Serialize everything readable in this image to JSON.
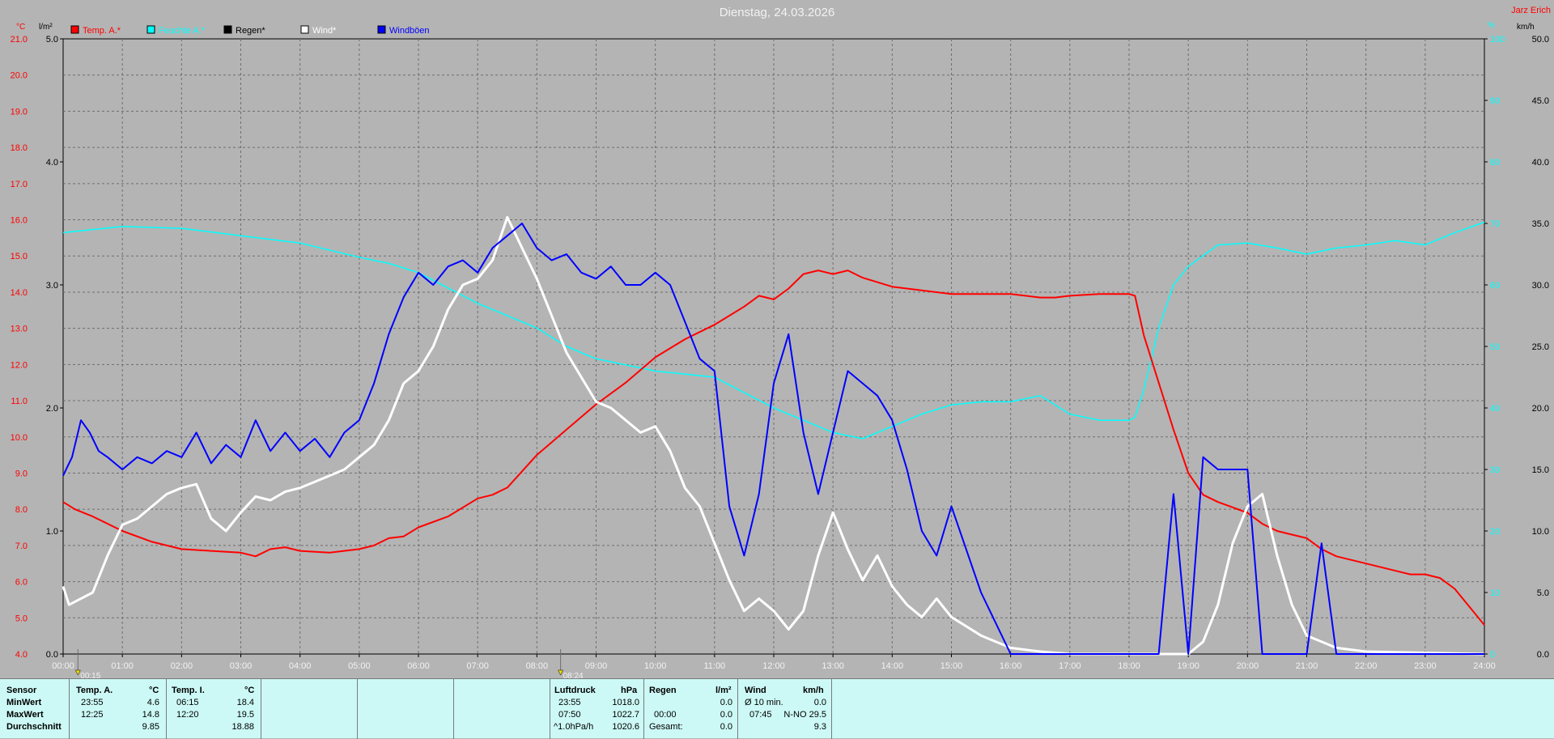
{
  "title": "Dienstag, 24.03.2026",
  "station": "Jarz Erich",
  "legend": [
    {
      "label": "Temp. A.*",
      "color": "#ff0000"
    },
    {
      "label": "Feuchte A.*",
      "color": "#00ffff"
    },
    {
      "label": "Regen*",
      "color": "#000000"
    },
    {
      "label": "Wind*",
      "color": "#ffffff"
    },
    {
      "label": "Windböen",
      "color": "#0000ff"
    }
  ],
  "axes": {
    "left_temp_unit": "°C",
    "left_rain_unit": "l/m²",
    "right_hum_unit": "%",
    "right_wind_unit": "km/h",
    "temp_ticks": [
      "21.0",
      "20.0",
      "19.0",
      "18.0",
      "17.0",
      "16.0",
      "15.0",
      "14.0",
      "13.0",
      "12.0",
      "11.0",
      "10.0",
      "9.0",
      "8.0",
      "7.0",
      "6.0",
      "5.0",
      "4.0"
    ],
    "rain_ticks": [
      "5.0",
      "4.0",
      "3.0",
      "2.0",
      "1.0",
      "0.0"
    ],
    "hum_ticks": [
      "100",
      "90",
      "80",
      "70",
      "60",
      "50",
      "40",
      "30",
      "20",
      "10",
      "0"
    ],
    "wind_ticks": [
      "50.0",
      "45.0",
      "40.0",
      "35.0",
      "30.0",
      "25.0",
      "20.0",
      "15.0",
      "10.0",
      "5.0",
      "0.0"
    ],
    "time_ticks": [
      "00:00",
      "01:00",
      "02:00",
      "03:00",
      "04:00",
      "05:00",
      "06:00",
      "07:00",
      "08:00",
      "09:00",
      "10:00",
      "11:00",
      "12:00",
      "13:00",
      "14:00",
      "15:00",
      "16:00",
      "17:00",
      "18:00",
      "19:00",
      "20:00",
      "21:00",
      "22:00",
      "23:00",
      "24:00"
    ],
    "markers": [
      "00:15",
      "08:24"
    ]
  },
  "chart_data": {
    "type": "line",
    "title": "Dienstag, 24.03.2026",
    "x_unit": "hours",
    "temp_range": [
      4,
      21
    ],
    "rain_range": [
      0,
      5
    ],
    "hum_range": [
      0,
      100
    ],
    "wind_range": [
      0,
      50
    ],
    "grid": true,
    "legend_position": "top-left",
    "series": [
      {
        "name": "Temp. A.*",
        "axis": "temp",
        "color": "#ff0000",
        "x": [
          0,
          0.2,
          0.5,
          1,
          1.5,
          2,
          2.5,
          3,
          3.25,
          3.5,
          3.75,
          4,
          4.5,
          5,
          5.25,
          5.5,
          5.75,
          6,
          6.5,
          7,
          7.25,
          7.5,
          8,
          8.5,
          9,
          9.5,
          10,
          10.5,
          11,
          11.5,
          11.75,
          12,
          12.25,
          12.5,
          12.75,
          13,
          13.25,
          13.5,
          14,
          14.5,
          15,
          15.5,
          16,
          16.25,
          16.5,
          16.75,
          17,
          17.5,
          18,
          18.1,
          18.25,
          18.5,
          18.75,
          19,
          19.25,
          19.5,
          20,
          20.25,
          20.5,
          20.75,
          21,
          21.25,
          21.5,
          22,
          22.5,
          22.75,
          23,
          23.25,
          23.5,
          23.75,
          24
        ],
        "values": [
          8.2,
          8.0,
          7.8,
          7.4,
          7.1,
          6.9,
          6.85,
          6.8,
          6.7,
          6.9,
          6.95,
          6.85,
          6.8,
          6.9,
          7.0,
          7.2,
          7.25,
          7.5,
          7.8,
          8.3,
          8.4,
          8.6,
          9.5,
          10.2,
          10.9,
          11.5,
          12.2,
          12.7,
          13.1,
          13.6,
          13.9,
          13.8,
          14.1,
          14.5,
          14.6,
          14.5,
          14.6,
          14.4,
          14.15,
          14.05,
          13.95,
          13.95,
          13.95,
          13.9,
          13.85,
          13.85,
          13.9,
          13.95,
          13.95,
          13.9,
          12.8,
          11.5,
          10.2,
          9.0,
          8.4,
          8.2,
          7.9,
          7.6,
          7.4,
          7.3,
          7.2,
          6.9,
          6.7,
          6.5,
          6.3,
          6.2,
          6.2,
          6.1,
          5.8,
          5.3,
          4.8
        ]
      },
      {
        "name": "Feuchte A.*",
        "axis": "hum",
        "color": "#00ffff",
        "x": [
          0,
          0.5,
          1,
          2,
          3,
          4,
          5,
          5.5,
          6,
          7,
          8,
          8.5,
          9,
          10,
          11,
          12,
          13,
          13.5,
          14,
          14.5,
          15,
          15.5,
          16,
          16.5,
          17,
          17.5,
          18,
          18.1,
          18.25,
          18.5,
          18.75,
          19,
          19.5,
          20,
          20.5,
          21,
          21.5,
          22,
          22.5,
          23,
          23.5,
          24
        ],
        "values": [
          68.5,
          69,
          69.5,
          69.2,
          68,
          66.8,
          64.5,
          63.5,
          62,
          57,
          53,
          50,
          48,
          46,
          45,
          40,
          36,
          35,
          37,
          39,
          40.5,
          41,
          41,
          42,
          39,
          38,
          38,
          38.5,
          43,
          53,
          60,
          63,
          66.5,
          66.8,
          66,
          65,
          66,
          66.5,
          67.2,
          66.5,
          68.5,
          70.2
        ]
      },
      {
        "name": "Wind*",
        "axis": "wind",
        "color": "#ffffff",
        "x": [
          0,
          0.1,
          0.3,
          0.5,
          0.75,
          1,
          1.25,
          1.5,
          1.75,
          2,
          2.25,
          2.5,
          2.75,
          3,
          3.25,
          3.5,
          3.75,
          4,
          4.25,
          4.5,
          4.75,
          5,
          5.25,
          5.5,
          5.75,
          6,
          6.25,
          6.5,
          6.75,
          7,
          7.25,
          7.5,
          7.75,
          8,
          8.25,
          8.5,
          8.75,
          9,
          9.25,
          9.5,
          9.75,
          10,
          10.25,
          10.5,
          10.75,
          11,
          11.25,
          11.5,
          11.75,
          12,
          12.25,
          12.5,
          12.75,
          13,
          13.25,
          13.5,
          13.75,
          14,
          14.25,
          14.5,
          14.75,
          15,
          15.5,
          16,
          16.5,
          17,
          19,
          19.25,
          19.5,
          19.75,
          20,
          20.25,
          20.5,
          20.75,
          21,
          21.5,
          22,
          24
        ],
        "values": [
          5.5,
          4,
          4.5,
          5,
          8,
          10.5,
          11,
          12,
          13,
          13.5,
          13.8,
          11,
          10,
          11.5,
          12.8,
          12.5,
          13.2,
          13.5,
          14,
          14.5,
          15,
          16,
          17,
          19,
          22,
          23,
          25,
          28,
          30,
          30.5,
          32,
          35.5,
          33,
          30.5,
          27.5,
          24.5,
          22.5,
          20.5,
          20,
          19,
          18,
          18.5,
          16.5,
          13.5,
          12,
          9,
          6,
          3.5,
          4.5,
          3.5,
          2,
          3.5,
          8,
          11.5,
          8.5,
          6,
          8,
          5.5,
          4,
          3,
          4.5,
          3,
          1.5,
          0.5,
          0.2,
          0,
          0,
          1,
          4,
          9,
          12,
          13,
          8,
          4,
          1.5,
          0.5,
          0.2,
          0
        ]
      },
      {
        "name": "Windböen",
        "axis": "wind",
        "color": "#0000ff",
        "x": [
          0,
          0.15,
          0.3,
          0.45,
          0.6,
          0.75,
          1,
          1.25,
          1.5,
          1.75,
          2,
          2.25,
          2.5,
          2.75,
          3,
          3.25,
          3.5,
          3.75,
          4,
          4.25,
          4.5,
          4.75,
          5,
          5.25,
          5.5,
          5.75,
          6,
          6.25,
          6.5,
          6.75,
          7,
          7.25,
          7.5,
          7.75,
          8,
          8.25,
          8.5,
          8.75,
          9,
          9.25,
          9.5,
          9.75,
          10,
          10.25,
          10.5,
          10.75,
          11,
          11.25,
          11.5,
          11.75,
          12,
          12.25,
          12.5,
          12.75,
          13,
          13.25,
          13.5,
          13.75,
          14,
          14.25,
          14.5,
          14.75,
          15,
          15.5,
          16,
          18.5,
          18.75,
          19,
          19.25,
          19.5,
          20,
          20.25,
          20.5,
          21,
          21.25,
          21.5,
          24
        ],
        "values": [
          14.5,
          16,
          19,
          18,
          16.5,
          16,
          15,
          16,
          15.5,
          16.5,
          16,
          18,
          15.5,
          17,
          16,
          19,
          16.5,
          18,
          16.5,
          17.5,
          16,
          18,
          19,
          22,
          26,
          29,
          31,
          30,
          31.5,
          32,
          31,
          33,
          34,
          35,
          33,
          32,
          32.5,
          31,
          30.5,
          31.5,
          30,
          30,
          31,
          30,
          27,
          24,
          23,
          12,
          8,
          13,
          22,
          26,
          18,
          13,
          18,
          23,
          22,
          21,
          19,
          15,
          10,
          8,
          12,
          5,
          0,
          0,
          13,
          0,
          16,
          15,
          15,
          0,
          0,
          0,
          9,
          0,
          0
        ]
      }
    ]
  },
  "summary": {
    "sensor": {
      "header": "Sensor",
      "rows": [
        "MinWert",
        "MaxWert",
        "Durchschnitt"
      ]
    },
    "temp_a": {
      "header": "Temp. A.",
      "unit": "°C",
      "min_time": "23:55",
      "min_val": "4.6",
      "max_time": "12:25",
      "max_val": "14.8",
      "avg": "9.85"
    },
    "temp_i": {
      "header": "Temp. I.",
      "unit": "°C",
      "min_time": "06:15",
      "min_val": "18.4",
      "max_time": "12:20",
      "max_val": "19.5",
      "avg": "18.88"
    },
    "pressure": {
      "header": "Luftdruck",
      "unit": "hPa",
      "min_time": "23:55",
      "min_val": "1018.0",
      "max_time": "07:50",
      "max_val": "1022.7",
      "trend_label": "^1.0hPa/h",
      "trend_val": "1020.6"
    },
    "rain": {
      "header": "Regen",
      "unit": "l/m²",
      "row2_time": "00:00",
      "row2_val": "0.0",
      "row1_val": "0.0",
      "total_label": "Gesamt:",
      "total_val": "0.0"
    },
    "wind": {
      "header": "Wind",
      "unit": "km/h",
      "avg_label": "Ø 10 min.",
      "avg_val": "0.0",
      "max_time": "07:45",
      "max_val": "N-NO 29.5",
      "mean": "9.3"
    }
  }
}
